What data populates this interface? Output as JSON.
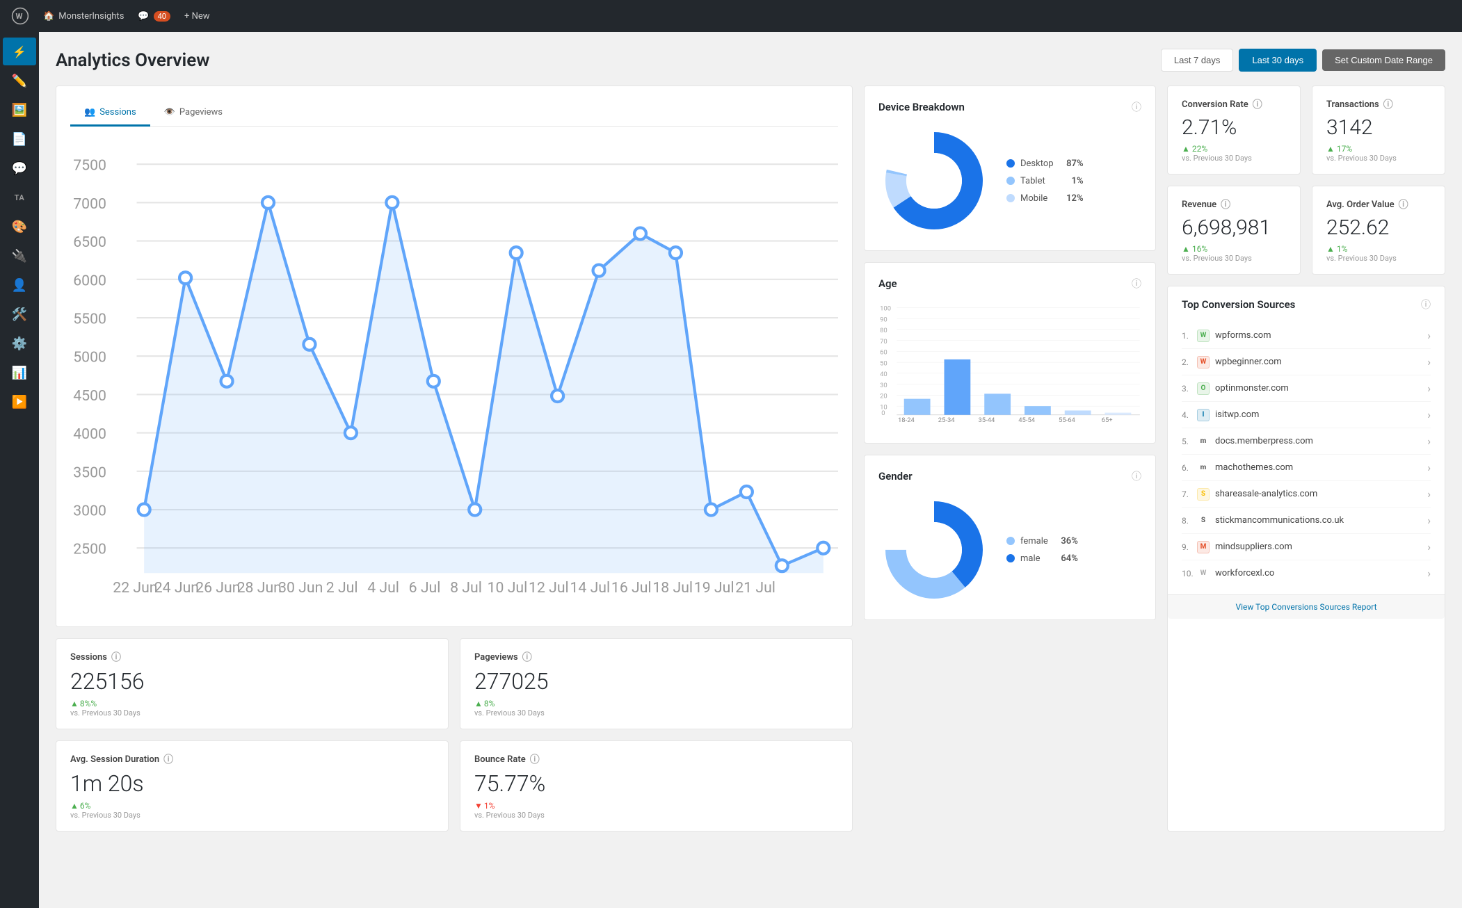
{
  "adminBar": {
    "siteName": "MonsterInsights",
    "comments": "40",
    "newLabel": "+ New"
  },
  "pageHeader": {
    "title": "Analytics Overview",
    "last7days": "Last 7 days",
    "last30days": "Last 30 days",
    "customRange": "Set Custom Date Range"
  },
  "chartTabs": {
    "sessions": "Sessions",
    "pageviews": "Pageviews"
  },
  "chartData": {
    "yLabels": [
      "7500",
      "7000",
      "6500",
      "6000",
      "5500",
      "5000",
      "4500",
      "4000",
      "3500",
      "3000",
      "2500"
    ],
    "xLabels": [
      "22 Jun",
      "24 Jun",
      "26 Jun",
      "28 Jun",
      "30 Jun",
      "2 Jul",
      "4 Jul",
      "6 Jul",
      "8 Jul",
      "10 Jul",
      "12 Jul",
      "14 Jul",
      "16 Jul",
      "18 Jul",
      "19 Jul",
      "21 Jul"
    ]
  },
  "stats": {
    "sessions": {
      "label": "Sessions",
      "value": "225156",
      "change": "8%%",
      "changeDir": "up",
      "sub": "vs. Previous 30 Days"
    },
    "pageviews": {
      "label": "Pageviews",
      "value": "277025",
      "change": "8%",
      "changeDir": "up",
      "sub": "vs. Previous 30 Days"
    },
    "avgSession": {
      "label": "Avg. Session Duration",
      "value": "1m 20s",
      "change": "6%",
      "changeDir": "up",
      "sub": "vs. Previous 30 Days"
    },
    "bounceRate": {
      "label": "Bounce Rate",
      "value": "75.77%",
      "change": "1%",
      "changeDir": "down",
      "sub": "vs. Previous 30 Days"
    }
  },
  "deviceBreakdown": {
    "title": "Device Breakdown",
    "items": [
      {
        "label": "Desktop",
        "pct": "87%",
        "color": "#1a73e8",
        "value": 87
      },
      {
        "label": "Tablet",
        "pct": "1%",
        "color": "#93c5fd",
        "value": 1
      },
      {
        "label": "Mobile",
        "pct": "12%",
        "color": "#bfdbfe",
        "value": 12
      }
    ]
  },
  "age": {
    "title": "Age",
    "bars": [
      {
        "label": "18-24",
        "value": 15
      },
      {
        "label": "25-34",
        "value": 52
      },
      {
        "label": "35-44",
        "value": 20
      },
      {
        "label": "45-54",
        "value": 8
      },
      {
        "label": "55-64",
        "value": 4
      },
      {
        "label": "65+",
        "value": 2
      }
    ],
    "yLabels": [
      "100",
      "90",
      "80",
      "70",
      "60",
      "50",
      "40",
      "30",
      "20",
      "10",
      "0"
    ]
  },
  "gender": {
    "title": "Gender",
    "items": [
      {
        "label": "female",
        "pct": "36%",
        "color": "#93c5fd",
        "value": 36
      },
      {
        "label": "male",
        "pct": "64%",
        "color": "#1a73e8",
        "value": 64
      }
    ]
  },
  "metrics": {
    "conversionRate": {
      "label": "Conversion Rate",
      "value": "2.71%",
      "change": "22%",
      "changeDir": "up",
      "sub": "vs. Previous 30 Days"
    },
    "transactions": {
      "label": "Transactions",
      "value": "3142",
      "change": "17%",
      "changeDir": "up",
      "sub": "vs. Previous 30 Days"
    },
    "revenue": {
      "label": "Revenue",
      "value": "6,698,981",
      "change": "16%",
      "changeDir": "up",
      "sub": "vs. Previous 30 Days"
    },
    "avgOrderValue": {
      "label": "Avg. Order Value",
      "value": "252.62",
      "change": "1%",
      "changeDir": "up",
      "sub": "vs. Previous 30 Days"
    }
  },
  "topConversionSources": {
    "title": "Top Conversion Sources",
    "sources": [
      {
        "num": "1.",
        "name": "wpforms.com",
        "color": "#4caf50"
      },
      {
        "num": "2.",
        "name": "wpbeginner.com",
        "color": "#e44d26"
      },
      {
        "num": "3.",
        "name": "optinmonster.com",
        "color": "#4caf50"
      },
      {
        "num": "4.",
        "name": "isitwp.com",
        "color": "#0073aa"
      },
      {
        "num": "5.",
        "name": "docs.memberpress.com",
        "color": "#555"
      },
      {
        "num": "6.",
        "name": "machothemes.com",
        "color": "#555"
      },
      {
        "num": "7.",
        "name": "shareasale-analytics.com",
        "color": "#f9c00c"
      },
      {
        "num": "8.",
        "name": "stickmancommunications.co.uk",
        "color": "#555"
      },
      {
        "num": "9.",
        "name": "mindsuppliers.com",
        "color": "#e44d26"
      },
      {
        "num": "10.",
        "name": "workforcexl.co",
        "color": "#aaa"
      }
    ],
    "viewReport": "View Top Conversions Sources Report"
  },
  "sidebar": {
    "items": [
      {
        "icon": "🏠",
        "label": "Dashboard"
      },
      {
        "icon": "✏️",
        "label": "Posts"
      },
      {
        "icon": "🗨️",
        "label": "Media"
      },
      {
        "icon": "📄",
        "label": "Pages"
      },
      {
        "icon": "💬",
        "label": "Comments"
      },
      {
        "icon": "TA",
        "label": "TA"
      },
      {
        "icon": "🔧",
        "label": "Appearance"
      },
      {
        "icon": "🔌",
        "label": "Plugins"
      },
      {
        "icon": "👤",
        "label": "Users"
      },
      {
        "icon": "🛠️",
        "label": "Tools"
      },
      {
        "icon": "⚙️",
        "label": "Settings"
      },
      {
        "icon": "📊",
        "label": "Analytics"
      },
      {
        "icon": "▶️",
        "label": "Play"
      }
    ]
  }
}
